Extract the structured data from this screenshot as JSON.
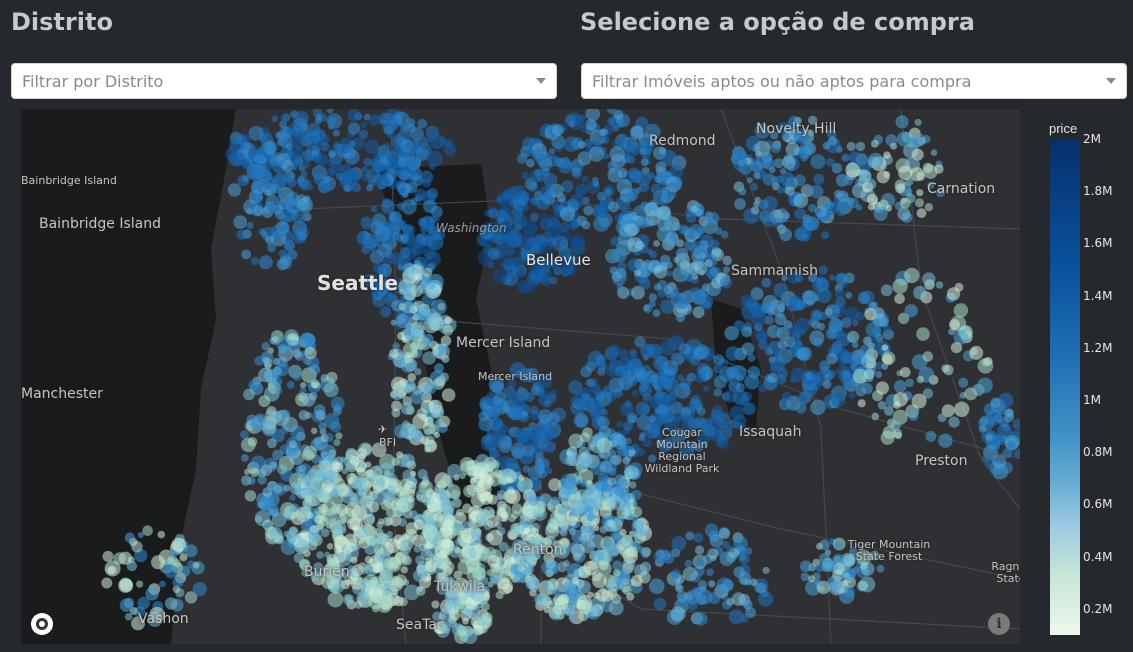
{
  "filters": {
    "district": {
      "heading": "Distrito",
      "placeholder": "Filtrar por Distrito"
    },
    "purchase": {
      "heading": "Selecione a opção de compra",
      "placeholder": "Filtrar Imóveis aptos ou não aptos para compra"
    }
  },
  "map": {
    "labels": {
      "seattle": "Seattle",
      "bellevue": "Bellevue",
      "redmond": "Redmond",
      "novelty_hill": "Novelty Hill",
      "carnation": "Carnation",
      "bainbridge_island": "Bainbridge Island",
      "bainbridge_island_left": "Bainbridge Island",
      "manchester": "Manchester",
      "mercer_island": "Mercer Island",
      "mercer_island_2": "Mercer Island",
      "sammamish": "Sammamish",
      "issaquah": "Issaquah",
      "cougar_mountain": "Cougar Mountain Regional Wildland Park",
      "preston": "Preston",
      "bfi": "BFI",
      "renton": "Renton",
      "burien": "Burien",
      "tukwila": "Tukwila",
      "seatac": "SeaTac",
      "vashon": "Vashon",
      "tiger_mountain": "Tiger Mountain State Forest",
      "ragnar_state": "Ragnar State",
      "washington": "Washington"
    },
    "colors": {
      "land": "#2f3033",
      "water": "#1a1b1d",
      "road": "#404246"
    }
  },
  "colorbar": {
    "title": "price",
    "ticks": [
      "2M",
      "1.8M",
      "1.6M",
      "1.4M",
      "1.2M",
      "1M",
      "0.8M",
      "0.6M",
      "0.4M",
      "0.2M"
    ],
    "scale_colors": [
      "#08306b",
      "#08519c",
      "#2171b5",
      "#4292c6",
      "#6baed6",
      "#9ecae1",
      "#c6e6d8",
      "#eef8ec"
    ]
  }
}
